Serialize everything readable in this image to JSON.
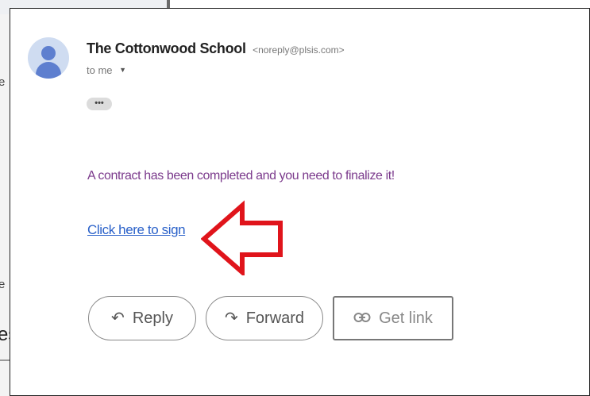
{
  "background_window": {
    "left_fragment_text_1": "e",
    "left_fragment_text_2": "e",
    "bottom_fragment_text": "es"
  },
  "email": {
    "sender_name": "The Cottonwood School",
    "sender_email": "<noreply@plsis.com>",
    "recipient_label": "to me",
    "ellipsis_label": "•••",
    "body_text": "A contract has been completed and you need to finalize it!",
    "link_text": "Click here to sign"
  },
  "actions": {
    "reply_label": "Reply",
    "forward_label": "Forward",
    "get_link_label": "Get link"
  },
  "icons": {
    "avatar": "person-avatar-icon",
    "recipient_dropdown": "caret-down-icon",
    "reply": "reply-arrow-icon",
    "forward": "forward-arrow-icon",
    "get_link": "link-icon",
    "annotation": "red-outline-arrow-icon"
  },
  "colors": {
    "body_text": "#7b3a8c",
    "link": "#2a61c9",
    "annotation_arrow": "#e0141b",
    "avatar_fill": "#5e7fcf"
  }
}
